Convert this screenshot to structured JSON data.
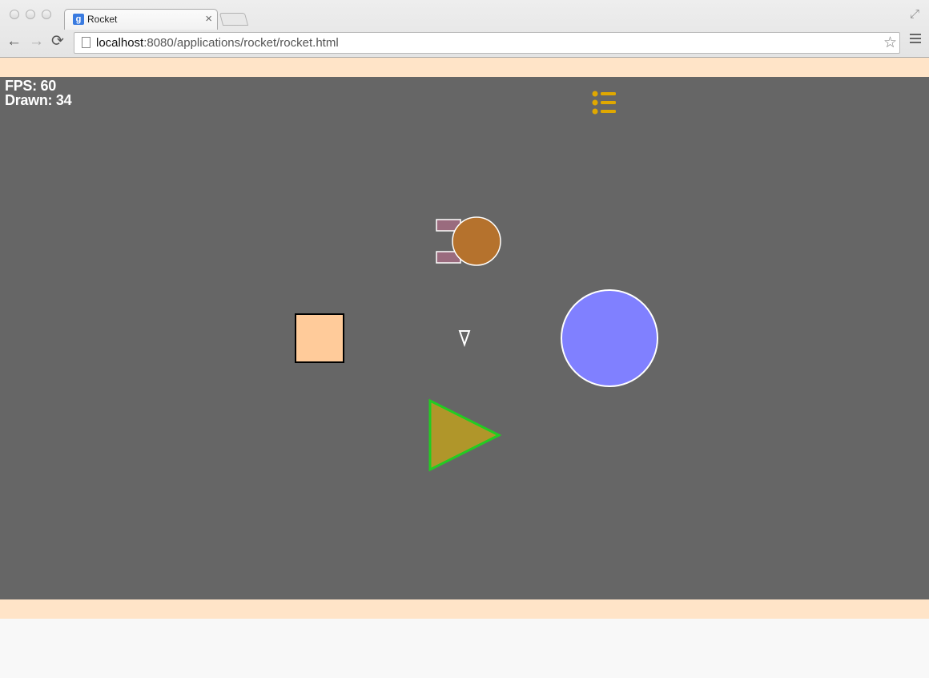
{
  "browser": {
    "tab_title": "Rocket",
    "tab_close": "×",
    "url_host": "localhost",
    "url_rest": ":8080/applications/rocket/rocket.html",
    "buttons": {
      "back": "←",
      "forward": "→",
      "reload": "⟳",
      "bookmark": "☆",
      "fullscreen": "⤢"
    },
    "favicon_letter": "g"
  },
  "hud": {
    "fps_label": "FPS: 60",
    "drawn_label": "Drawn: 34"
  },
  "menu_icon": {
    "name": "list-icon",
    "color": "#e0a800"
  },
  "colors": {
    "band": "#ffe4c8",
    "stage": "#666666",
    "rocket_body": "#b5722d",
    "rocket_thruster": "#9a6b7e",
    "square": "#ffcb9a",
    "circle": "#8080ff",
    "triangle_fill": "#b0962a",
    "triangle_stroke": "#22cc22"
  }
}
